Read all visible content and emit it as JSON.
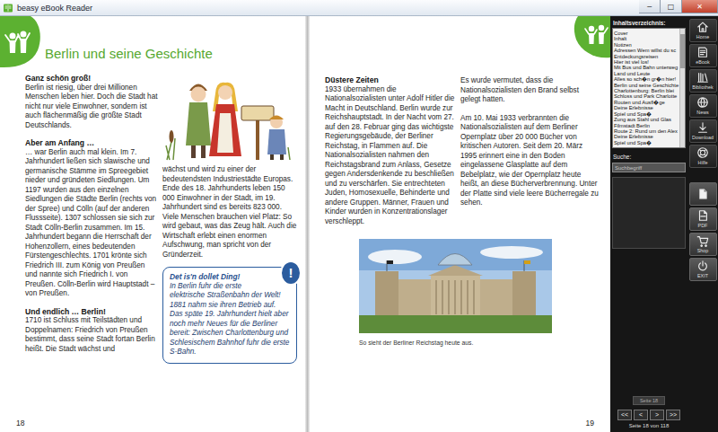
{
  "window": {
    "title": "beasy eBook Reader",
    "controls": [
      "−",
      "□",
      "✕"
    ]
  },
  "left_page": {
    "title": "Berlin und seine Geschichte",
    "number": "18",
    "columns": [
      [
        {
          "kind": "heading",
          "text": "Ganz schön groß!"
        },
        {
          "kind": "paragraph",
          "text": "Berlin ist riesig, über drei Millionen Menschen leben hier. Doch die Stadt hat nicht nur viele Einwohner, sondern ist auch flächenmäßig die größte Stadt Deutschlands."
        },
        {
          "kind": "heading",
          "text": "Aber am Anfang …"
        },
        {
          "kind": "paragraph",
          "text": "… war Berlin auch mal klein. Im 7. Jahrhundert ließen sich slawische und germanische Stämme im Spreegebiet nieder und gründeten Siedlungen. Um 1197 wurden aus den einzelnen Siedlungen die Städte Berlin (rechts von der Spree) und Cölln (auf der anderen Flussseite). 1307 schlossen sie sich zur Stadt Cölln-Berlin zusammen. Im 15. Jahrhundert begann die Herrschaft der Hohenzollern, eines bedeutenden Fürstengeschlechts. 1701 krönte sich Friedrich III. zum König von Preußen und nannte sich Friedrich I. von Preußen. Cölln-Berlin wird Hauptstadt – von Preußen."
        },
        {
          "kind": "heading",
          "text": "Und endlich … Berlin!"
        },
        {
          "kind": "paragraph",
          "text": "1710 ist Schluss mit Teilstädten und Doppelnamen: Friedrich von Preußen bestimmt, dass seine Stadt fortan Berlin heißt. Die Stadt wächst und"
        }
      ],
      [
        {
          "kind": "illustration"
        },
        {
          "kind": "paragraph",
          "text": "wächst und wird zu einer der bedeutendsten Industriestädte Europas. Ende des 18. Jahrhunderts leben 150 000 Einwohner in der Stadt, im 19. Jahrhundert sind es bereits 823 000. Viele Menschen brauchen viel Platz: So wird gebaut, was das Zeug hält. Auch die Wirtschaft erlebt einen enormen Aufschwung, man spricht von der Gründerzeit."
        },
        {
          "kind": "infobox",
          "badge": "!",
          "title": "Det is'n dollet Ding!",
          "text": "In Berlin fuhr die erste elektrische Straßenbahn der Welt! 1881 nahm sie ihren Betrieb auf. Das späte 19. Jahrhundert hielt aber noch mehr Neues für die Berliner bereit: Zwischen Charlottenburg und Schlesischem Bahnhof fuhr die erste S-Bahn."
        }
      ]
    ]
  },
  "right_page": {
    "number": "19",
    "columns": [
      [
        {
          "kind": "heading",
          "text": "Düstere Zeiten"
        },
        {
          "kind": "paragraph",
          "text": "1933 übernahmen die Nationalsozialisten unter Adolf Hitler die Macht in Deutschland. Berlin wurde zur Reichshauptstadt. In der Nacht vom 27. auf den 28. Februar ging das wichtigste Regierungsgebäude, der Berliner Reichstag, in Flammen auf. Die Nationalsozialisten nahmen den Reichstagsbrand zum Anlass, Gesetze gegen Andersdenkende zu beschließen und zu verschärfen. Sie entrechteten Juden, Homosexuelle, Behinderte und andere Gruppen. Männer, Frauen und Kinder wurden in Konzentrationslager verschleppt."
        }
      ],
      [
        {
          "kind": "paragraph",
          "text": "Es wurde vermutet, dass die Nationalsozialisten den Brand selbst gelegt hatten."
        },
        {
          "kind": "paragraph",
          "text": "Am 10. Mai 1933 verbrannten die Nationalsozialisten auf dem Berliner Opernplatz über 20 000 Bücher von kritischen Autoren. Seit dem 20. März 1995 erinnert eine in den Boden eingelassene Glasplatte auf dem Bebelplatz, wie der Opernplatz heute heißt, an diese Bücherverbrennung. Unter der Platte sind viele leere Bücherregale zu sehen."
        }
      ]
    ],
    "photo_caption": "So sieht der Berliner Reichstag heute aus."
  },
  "sidebar": {
    "toc_title": "Inhaltsverzeichnis:",
    "toc": [
      "Cover",
      "Inhalt",
      "Notizen",
      "Adressen Wem willst du sc",
      "Entdeckungsreisen",
      "Hier ist viel los!",
      "Mit Bus und Bahn unterweg",
      "Land und Leute",
      "Alles so sch�n gr�n hier!",
      "Berlin und seine Geschichte",
      "Charlottenburg: Berlin blei",
      "Schloss und Park Charlotte",
      "Routen und Ausfl�ge",
      "Deine Erlebnisse",
      "Spiel und Spa�",
      "Zung aus Stahl und Glas",
      "Filmstadt Berlin",
      "Route 2: Rund um den Alex",
      "Deine Erlebnisse",
      "Spiel und Spa�"
    ],
    "search": {
      "label": "Suche:",
      "placeholder": "Suchbegriff"
    },
    "page_field": "Seite 18",
    "nav": [
      "<<",
      "<",
      ">",
      ">>"
    ],
    "page_status": "Seite 18 von 118",
    "top_buttons": [
      "Home",
      "eBook",
      "Bibliothek",
      "News",
      "Download",
      "Hilfe"
    ],
    "bottom_buttons": [
      "PDF",
      "Shop",
      "EXIT"
    ]
  }
}
